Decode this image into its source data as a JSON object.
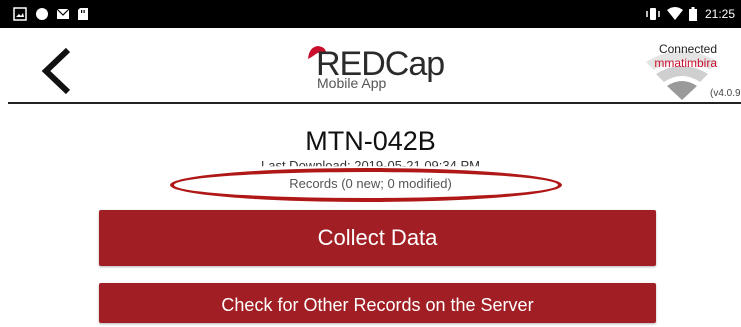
{
  "status_bar": {
    "time": "21:25",
    "left_icons": [
      "image-icon",
      "circle-icon",
      "mail-icon",
      "sd-card-icon"
    ],
    "right_icons": [
      "vibrate-icon",
      "wifi-icon",
      "battery-icon"
    ]
  },
  "header": {
    "back_icon": "chevron-left-icon",
    "logo": {
      "title": "REDCap",
      "subtitle": "Mobile App"
    },
    "connection": {
      "status": "Connected",
      "user": "mmatimbira",
      "version": "(v4.0.9"
    }
  },
  "main": {
    "project_name": "MTN-042B",
    "last_download": "Last Download: 2019-05-21 09:34 PM",
    "records_summary": "Records (0 new; 0 modified)",
    "collect_button": "Collect Data",
    "check_button": "Check for Other Records on the Server"
  },
  "colors": {
    "brand_red": "#a11f24",
    "annotation_red": "#b01818",
    "user_red": "#c8102e"
  }
}
